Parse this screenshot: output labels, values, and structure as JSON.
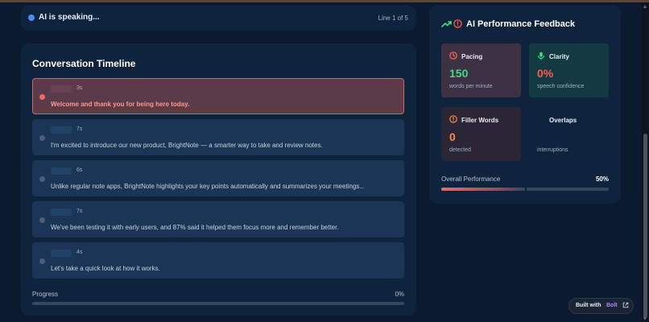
{
  "status": {
    "speaking_text": "AI is speaking...",
    "line_indicator": "Line 1 of 5"
  },
  "timeline": {
    "title": "Conversation Timeline",
    "items": [
      {
        "duration": "3s",
        "text": "Welcome and thank you for being here today.",
        "active": true
      },
      {
        "duration": "7s",
        "text": "I'm excited to introduce our new product, BrightNote — a smarter way to take and review notes.",
        "active": false
      },
      {
        "duration": "6s",
        "text": "Unlike regular note apps, BrightNote highlights your key points automatically and summarizes your meetings...",
        "active": false
      },
      {
        "duration": "7s",
        "text": "We've been testing it with early users, and 87% said it helped them focus more and remember better.",
        "active": false
      },
      {
        "duration": "4s",
        "text": "Let's take a quick look at how it works.",
        "active": false
      }
    ],
    "progress_label": "Progress",
    "progress_value": "0%",
    "progress_fraction": 0
  },
  "feedback": {
    "title": "AI Performance Feedback",
    "cards": {
      "pacing": {
        "title": "Pacing",
        "value": "150",
        "sub": "words per minute",
        "value_color": "#3ddc84"
      },
      "clarity": {
        "title": "Clarity",
        "value": "0%",
        "sub": "speech confidence",
        "value_color": "#ff5a4f"
      },
      "filler": {
        "title": "Filler Words",
        "value": "0",
        "sub": "detected",
        "value_color": "#ff8a3d"
      },
      "overlaps": {
        "title": "Overlaps",
        "value": "",
        "sub": "interruptions"
      }
    },
    "overall_label": "Overall Performance",
    "overall_value": "50%",
    "overall_fraction": 0.5
  },
  "built_with": {
    "prefix": "Built with",
    "brand": "Bolt"
  },
  "icons": {
    "status": "status-dot-icon",
    "header_trend": "trending-up-icon",
    "header_alert": "alert-circle-icon",
    "pacing": "clock-icon",
    "clarity": "microphone-icon",
    "filler": "alert-circle-icon",
    "external": "external-link-icon"
  },
  "colors": {
    "background": "#0b1a2e",
    "panel": "#10233d",
    "active_item": "#5b3a49",
    "accent_green": "#3ddc84",
    "accent_red": "#ff5a4f",
    "accent_orange": "#ff8a3d",
    "brand_purple": "#a78bfa"
  }
}
